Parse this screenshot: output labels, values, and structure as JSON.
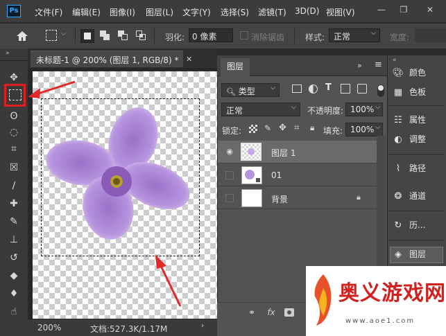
{
  "app": {
    "logo": "Ps"
  },
  "menu": [
    "文件(F)",
    "编辑(E)",
    "图像(I)",
    "图层(L)",
    "文字(Y)",
    "选择(S)",
    "滤镜(T)",
    "3D(D)",
    "视图(V)"
  ],
  "options": {
    "feather_label": "羽化:",
    "feather_value": "0 像素",
    "antialias_label": "消除锯齿",
    "style_label": "样式:",
    "style_value": "正常",
    "width_label": "宽度:"
  },
  "document": {
    "tab_title": "未标题-1 @ 200% (图层 1, RGB/8) *",
    "zoom": "200%",
    "doc_info": "文档:527.3K/1.17M"
  },
  "layers_panel": {
    "tab": "图层",
    "filter_kind": "类型",
    "blend_mode": "正常",
    "opacity_label": "不透明度:",
    "opacity_value": "100%",
    "lock_label": "锁定:",
    "fill_label": "填充:",
    "fill_value": "100%",
    "layers": [
      {
        "name": "图层 1",
        "visible": true,
        "selected": true
      },
      {
        "name": "01",
        "visible": false,
        "selected": false
      },
      {
        "name": "背景",
        "visible": false,
        "selected": false,
        "locked": true
      }
    ]
  },
  "dock": [
    "颜色",
    "色板",
    "属性",
    "调整",
    "路径",
    "通道",
    "历...",
    "图层"
  ],
  "watermark": {
    "title": "奥义游戏网",
    "url": "www.aoe1.com"
  },
  "colors": {
    "highlight_red": "#e02020",
    "flower": "#b08ad8",
    "ps_blue": "#31a8ff"
  },
  "icons": [
    "home-icon",
    "marquee-icon",
    "move-icon",
    "lasso-icon",
    "quick-select-icon",
    "crop-icon",
    "frame-icon",
    "eyedropper-icon",
    "healing-icon",
    "brush-icon",
    "stamp-icon",
    "history-brush-icon",
    "eraser-icon",
    "paint-bucket-icon",
    "smudge-icon",
    "eye-icon",
    "lock-icon",
    "link-icon",
    "fx-icon",
    "mask-icon",
    "trash-icon"
  ]
}
